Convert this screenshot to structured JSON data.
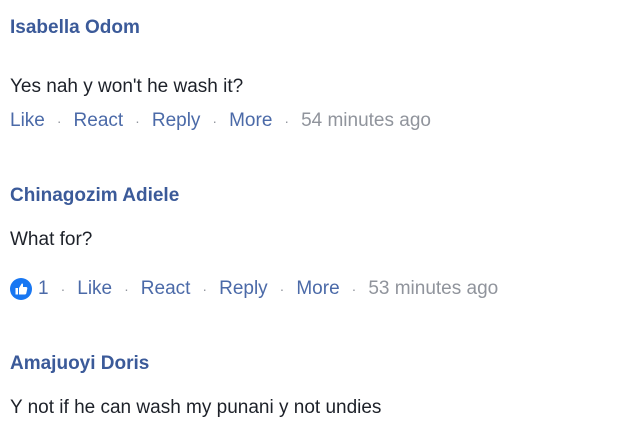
{
  "comments": [
    {
      "author": "Isabella Odom",
      "text": "Yes nah y won't he wash it?",
      "reaction_count": "",
      "actions": {
        "like": "Like",
        "react": "React",
        "reply": "Reply",
        "more": "More"
      },
      "time": "54 minutes ago"
    },
    {
      "author": "Chinagozim Adiele",
      "text": "What for?",
      "reaction_count": "1",
      "reaction_icon": "like-thumbs-up-icon",
      "actions": {
        "like": "Like",
        "react": "React",
        "reply": "Reply",
        "more": "More"
      },
      "time": "53 minutes ago"
    },
    {
      "author": "Amajuoyi Doris",
      "text": "Y not if he can wash my punani y not undies"
    }
  ],
  "separator": "·",
  "colors": {
    "author": "#3b5a99",
    "action_link": "#4b6aa8",
    "meta": "#90949c",
    "body_text": "#1d2129",
    "like_badge": "#1877f2"
  }
}
